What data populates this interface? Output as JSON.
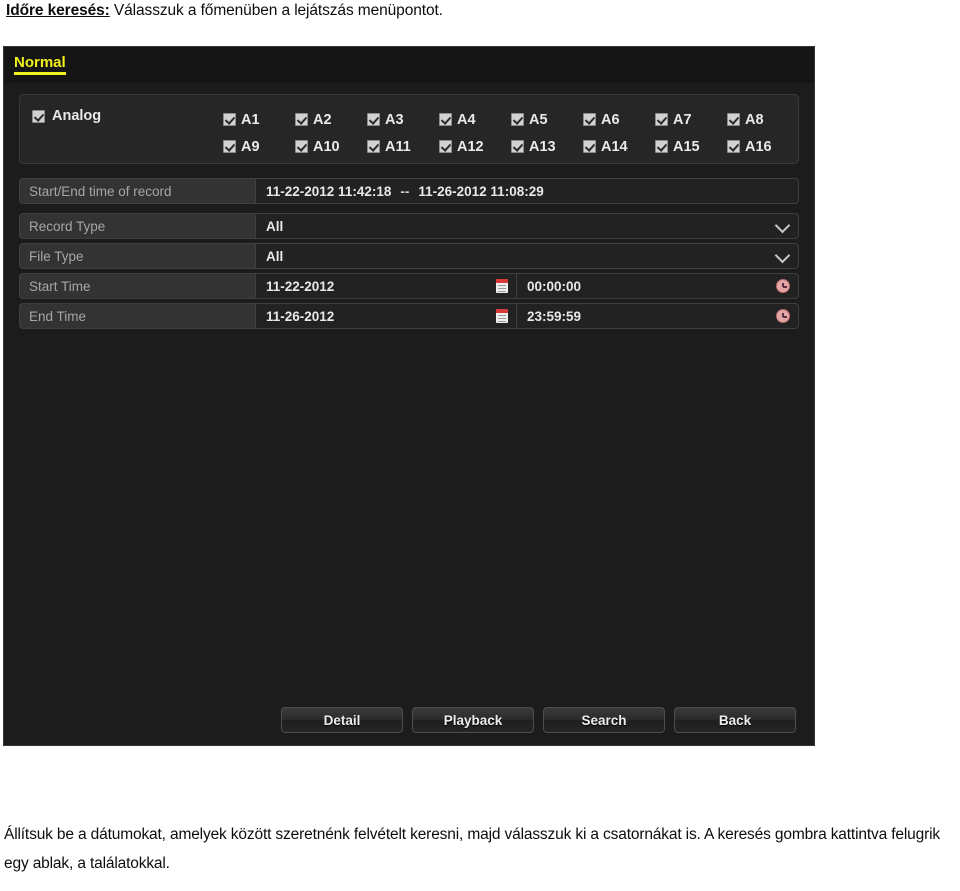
{
  "document": {
    "caption_top_bold": "Időre keresés:",
    "caption_top_rest": " Válasszuk a főmenüben a lejátszás menüpontot.",
    "caption_bottom": "Állítsuk be a dátumokat, amelyek között szeretnénk felvételt keresni, majd válasszuk ki a csatornákat is. A keresés gombra kattintva felugrik egy ablak, a találatokkal."
  },
  "colors": {
    "tab_active": "#f2f21c",
    "window_bg": "#1c1c1c",
    "row_label_bg": "#333333",
    "row_value_bg": "#222222",
    "calendar_accent": "#d83a3a",
    "clock_accent": "#e3a6a6"
  },
  "device": {
    "tabs": [
      {
        "label": "Normal",
        "active": true
      }
    ],
    "channels": {
      "group_label": "Analog",
      "group_checked": true,
      "items": [
        {
          "label": "A1",
          "checked": true
        },
        {
          "label": "A2",
          "checked": true
        },
        {
          "label": "A3",
          "checked": true
        },
        {
          "label": "A4",
          "checked": true
        },
        {
          "label": "A5",
          "checked": true
        },
        {
          "label": "A6",
          "checked": true
        },
        {
          "label": "A7",
          "checked": true
        },
        {
          "label": "A8",
          "checked": true
        },
        {
          "label": "A9",
          "checked": true
        },
        {
          "label": "A10",
          "checked": true
        },
        {
          "label": "A11",
          "checked": true
        },
        {
          "label": "A12",
          "checked": true
        },
        {
          "label": "A13",
          "checked": true
        },
        {
          "label": "A14",
          "checked": true
        },
        {
          "label": "A15",
          "checked": true
        },
        {
          "label": "A16",
          "checked": true
        }
      ]
    },
    "form": {
      "start_end_of_record": {
        "label": "Start/End time of record",
        "start": "11-22-2012 11:42:18",
        "separator": "--",
        "end": "11-26-2012 11:08:29"
      },
      "record_type": {
        "label": "Record Type",
        "value": "All",
        "options": [
          "All"
        ]
      },
      "file_type": {
        "label": "File Type",
        "value": "All",
        "options": [
          "All"
        ]
      },
      "start_time": {
        "label": "Start Time",
        "date": "11-22-2012",
        "time": "00:00:00"
      },
      "end_time": {
        "label": "End Time",
        "date": "11-26-2012",
        "time": "23:59:59"
      }
    },
    "buttons": [
      {
        "label": "Detail"
      },
      {
        "label": "Playback"
      },
      {
        "label": "Search"
      },
      {
        "label": "Back"
      }
    ]
  }
}
